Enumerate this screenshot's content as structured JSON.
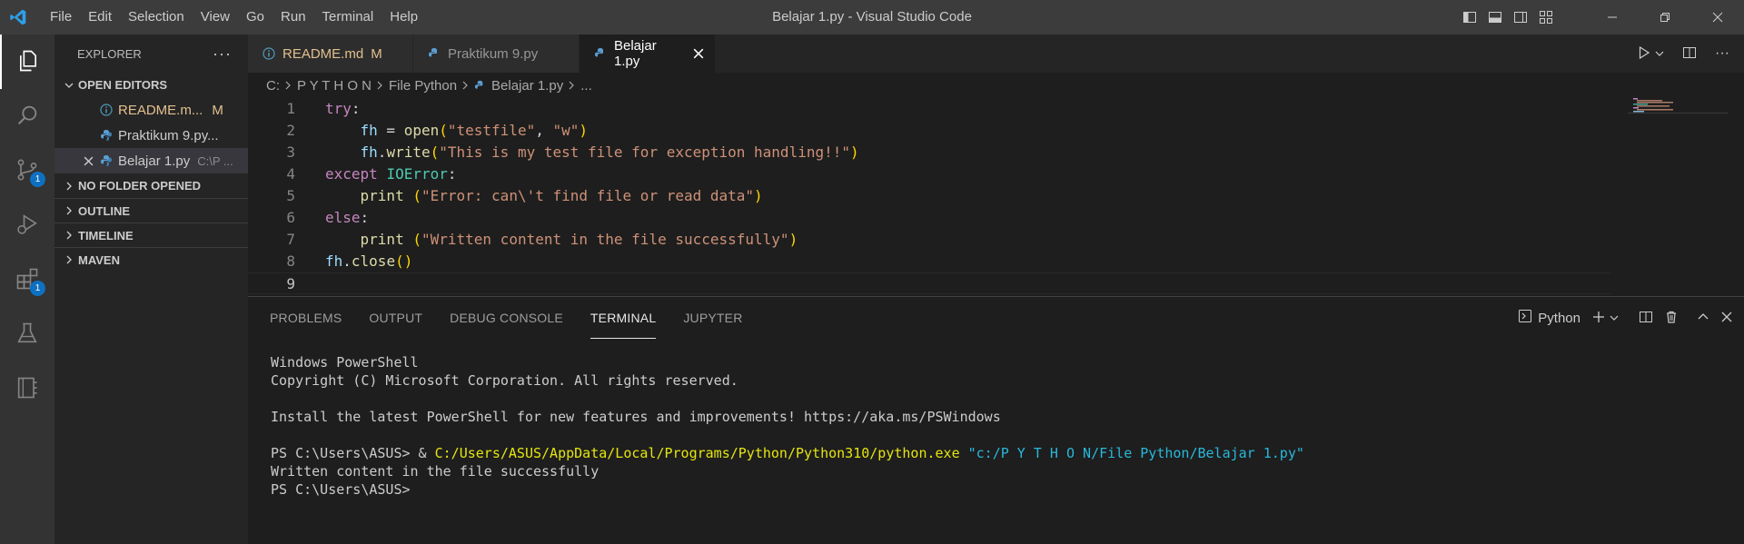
{
  "titlebar": {
    "menu": [
      "File",
      "Edit",
      "Selection",
      "View",
      "Go",
      "Run",
      "Terminal",
      "Help"
    ],
    "window_title": "Belajar 1.py - Visual Studio Code"
  },
  "activity_bar": {
    "items": [
      {
        "icon": "files-icon",
        "active": true
      },
      {
        "icon": "search-icon"
      },
      {
        "icon": "source-control-icon",
        "badge": "1"
      },
      {
        "icon": "run-debug-icon"
      },
      {
        "icon": "extensions-icon",
        "badge": "1"
      },
      {
        "icon": "testing-icon"
      },
      {
        "icon": "notebook-icon"
      }
    ]
  },
  "sidebar": {
    "title": "EXPLORER",
    "open_editors_label": "OPEN EDITORS",
    "open_editors": [
      {
        "name": "README.m...",
        "badge": "M",
        "icon": "info-icon"
      },
      {
        "name": "Praktikum 9.py...",
        "icon": "python-icon"
      },
      {
        "name": "Belajar 1.py",
        "desc": "C:\\P ...",
        "icon": "python-icon",
        "selected": true
      }
    ],
    "sections": [
      "NO FOLDER OPENED",
      "OUTLINE",
      "TIMELINE",
      "MAVEN"
    ]
  },
  "tabs": [
    {
      "label": "README.md",
      "modified": "M",
      "icon": "info-icon"
    },
    {
      "label": "Praktikum 9.py",
      "icon": "python-icon"
    },
    {
      "label": "Belajar 1.py",
      "icon": "python-icon",
      "active": true
    }
  ],
  "breadcrumb": [
    "C:",
    "P Y T H O N",
    "File Python",
    "Belajar 1.py",
    "..."
  ],
  "editor": {
    "line_numbers": [
      "1",
      "2",
      "3",
      "4",
      "5",
      "6",
      "7",
      "8",
      "9"
    ],
    "lines": [
      [
        [
          "kw",
          "try"
        ],
        [
          "pun",
          ":"
        ]
      ],
      [
        [
          "pun",
          "    "
        ],
        [
          "var",
          "fh"
        ],
        [
          "pun",
          " = "
        ],
        [
          "fn",
          "open"
        ],
        [
          "br1",
          "("
        ],
        [
          "str",
          "\"testfile\""
        ],
        [
          "pun",
          ", "
        ],
        [
          "str",
          "\"w\""
        ],
        [
          "br1",
          ")"
        ]
      ],
      [
        [
          "pun",
          "    "
        ],
        [
          "var",
          "fh"
        ],
        [
          "pun",
          "."
        ],
        [
          "fn",
          "write"
        ],
        [
          "br1",
          "("
        ],
        [
          "str",
          "\"This is my test file for exception handling!!\""
        ],
        [
          "br1",
          ")"
        ]
      ],
      [
        [
          "kw",
          "except"
        ],
        [
          "pun",
          " "
        ],
        [
          "cls",
          "IOError"
        ],
        [
          "pun",
          ":"
        ]
      ],
      [
        [
          "pun",
          "    "
        ],
        [
          "fn",
          "print"
        ],
        [
          "pun",
          " "
        ],
        [
          "br1",
          "("
        ],
        [
          "str",
          "\"Error: can\\'t find file or read data\""
        ],
        [
          "br1",
          ")"
        ]
      ],
      [
        [
          "kw",
          "else"
        ],
        [
          "pun",
          ":"
        ]
      ],
      [
        [
          "pun",
          "    "
        ],
        [
          "fn",
          "print"
        ],
        [
          "pun",
          " "
        ],
        [
          "br1",
          "("
        ],
        [
          "str",
          "\"Written content in the file successfully\""
        ],
        [
          "br1",
          ")"
        ]
      ],
      [
        [
          "var",
          "fh"
        ],
        [
          "pun",
          "."
        ],
        [
          "fn",
          "close"
        ],
        [
          "br1",
          "()"
        ]
      ],
      []
    ]
  },
  "panel": {
    "tabs": [
      "PROBLEMS",
      "OUTPUT",
      "DEBUG CONSOLE",
      "TERMINAL",
      "JUPYTER"
    ],
    "active_tab": "TERMINAL",
    "terminal_name": "Python",
    "terminal_lines": [
      {
        "text": "Windows PowerShell"
      },
      {
        "text": "Copyright (C) Microsoft Corporation. All rights reserved."
      },
      {
        "text": ""
      },
      {
        "text": "Install the latest PowerShell for new features and improvements! https://aka.ms/PSWindows"
      },
      {
        "text": ""
      },
      {
        "prompt": "PS C:\\Users\\ASUS> & ",
        "exe": "C:/Users/ASUS/AppData/Local/Programs/Python/Python310/python.exe",
        "arg": " \"c:/P Y T H O N/File Python/Belajar 1.py\""
      },
      {
        "text": "Written content in the file successfully"
      },
      {
        "text": "PS C:\\Users\\ASUS> "
      }
    ]
  },
  "colors": {
    "accent": "#0e70c0",
    "titlebar": "#3c3c3c",
    "activitybar": "#333333",
    "sidebar": "#252526",
    "editor": "#1e1e1e"
  }
}
